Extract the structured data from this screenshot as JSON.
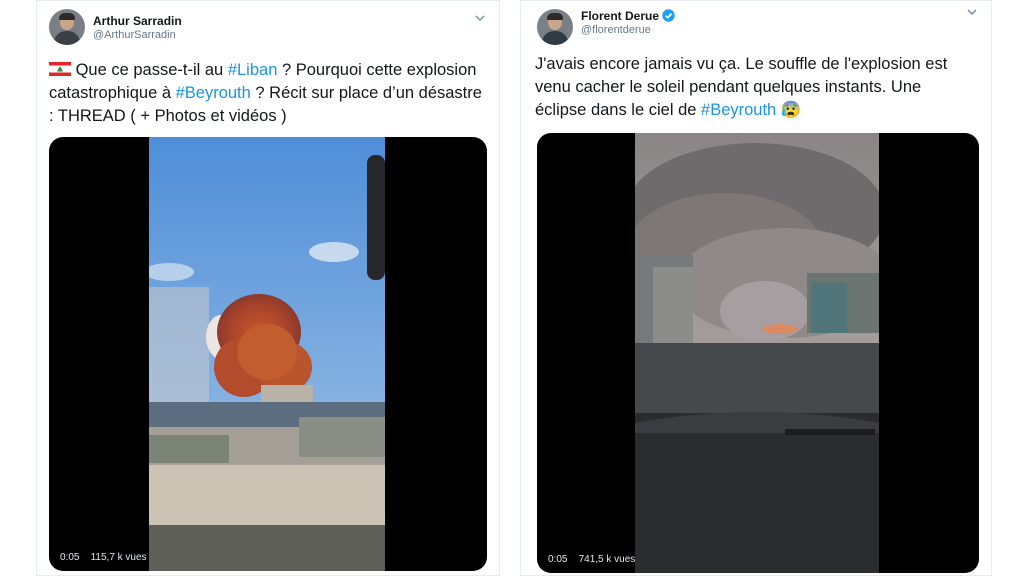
{
  "tweets": [
    {
      "display_name": "Arthur Sarradin",
      "handle": "@ArthurSarradin",
      "text": {
        "flag": "🇱🇧",
        "p1": " Que ce passe-t-il au  ",
        "tag1": "#Liban",
        "p2": " ? Pourquoi cette explosion catastrophique à  ",
        "tag2": "#Beyrouth",
        "p3": " ? Récit sur place d’un désastre : THREAD ( + Photos et vidéos )"
      },
      "video": {
        "time": "0:05",
        "views": "115,7 k vues"
      },
      "icons": [
        "chevron-down-icon",
        "lebanon-flag-icon"
      ]
    },
    {
      "display_name": "Florent Derue",
      "handle": "@florentderue",
      "verified": true,
      "text": {
        "p1": "J'avais encore jamais vu ça. Le souffle de l'explosion est venu cacher le soleil pendant quelques instants. Une éclipse dans le ciel de ",
        "tag1": "#Beyrouth",
        "emoji": " 😰"
      },
      "video": {
        "time": "0:05",
        "views": "741,5 k vues"
      },
      "icons": [
        "chevron-down-icon",
        "verified-badge-icon",
        "anxious-face-emoji"
      ]
    }
  ],
  "colors": {
    "hashtag": "#1b95e0",
    "verified": "#1da1f2",
    "secondary_text": "#657786"
  }
}
